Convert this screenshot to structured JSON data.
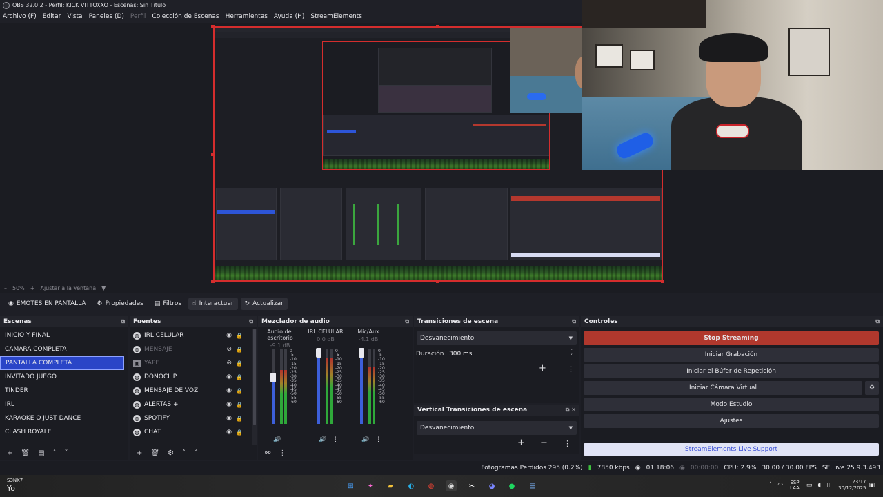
{
  "window": {
    "title": "OBS 32.0.2 - Perfil: KICK VITTOXXO - Escenas: Sin Título"
  },
  "menu": {
    "items": [
      {
        "label": "Archivo (F)",
        "dim": false
      },
      {
        "label": "Editar",
        "dim": false
      },
      {
        "label": "Vista",
        "dim": false
      },
      {
        "label": "Paneles (D)",
        "dim": false
      },
      {
        "label": "Perfil",
        "dim": true
      },
      {
        "label": "Colección de Escenas",
        "dim": false
      },
      {
        "label": "Herramientas",
        "dim": false
      },
      {
        "label": "Ayuda (H)",
        "dim": false
      },
      {
        "label": "StreamElements",
        "dim": false
      }
    ]
  },
  "zoom": {
    "minus": "–",
    "percent": "50%",
    "plus": "+",
    "fit": "Ajustar a la ventana",
    "dropdown": "▼"
  },
  "toolbar": {
    "scene_name": "EMOTES EN PANTALLA",
    "properties": "Propiedades",
    "filters": "Filtros",
    "interact": "Interactuar",
    "refresh": "Actualizar"
  },
  "scenes": {
    "title": "Escenas",
    "items": [
      "INICIO Y FINAL",
      "CAMARA COMPLETA",
      "PANTALLA COMPLETA",
      "INVITADO JUEGO",
      "TINDER",
      "IRL",
      "KARAOKE O JUST DANCE",
      "CLASH ROYALE"
    ],
    "selected_index": 2
  },
  "sources": {
    "title": "Fuentes",
    "items": [
      {
        "label": "IRL CELULAR",
        "dim": false,
        "icon": "globe-icon"
      },
      {
        "label": "MENSAJE",
        "dim": true,
        "icon": "globe-icon"
      },
      {
        "label": "YAPE",
        "dim": true,
        "icon": "image-icon"
      },
      {
        "label": "DONOCLIP",
        "dim": false,
        "icon": "globe-icon"
      },
      {
        "label": "MENSAJE DE VOZ",
        "dim": false,
        "icon": "globe-icon"
      },
      {
        "label": "ALERTAS +",
        "dim": false,
        "icon": "globe-icon"
      },
      {
        "label": "SPOTIFY",
        "dim": false,
        "icon": "globe-icon"
      },
      {
        "label": "CHAT",
        "dim": false,
        "icon": "globe-icon"
      }
    ]
  },
  "mixer": {
    "title": "Mezclador de audio",
    "channels": [
      {
        "name": "Audio del escritorio",
        "db": "-9.1 dB",
        "level": 0.72,
        "fader": 0.62
      },
      {
        "name": "IRL CELULAR",
        "db": "0.0 dB",
        "level": 0.88,
        "fader": 0.95
      },
      {
        "name": "Mic/Aux",
        "db": "-4.1 dB",
        "level": 0.76,
        "fader": 0.95
      }
    ],
    "scale": [
      "0",
      "-5",
      "-10",
      "-15",
      "-20",
      "-25",
      "-30",
      "-35",
      "-40",
      "-45",
      "-50",
      "-55",
      "-60"
    ]
  },
  "transitions": {
    "title": "Transiciones de escena",
    "selected": "Desvanecimiento",
    "duration_label": "Duración",
    "duration_value": "300 ms"
  },
  "vertical_transitions": {
    "title": "Vertical Transiciones de escena",
    "selected": "Desvanecimiento"
  },
  "controls": {
    "title": "Controles",
    "stop_streaming": "Stop Streaming",
    "start_recording": "Iniciar Grabación",
    "start_replay": "Iniciar el Búfer de Repetición",
    "start_vcam": "Iniciar Cámara Virtual",
    "studio_mode": "Modo Estudio",
    "settings": "Ajustes",
    "se_support": "StreamElements Live Support"
  },
  "status": {
    "dropped": "Fotogramas Perdidos 295 (0.2%)",
    "bitrate": "7850 kbps",
    "stream_time": "01:18:06",
    "rec_time": "00:00:00",
    "cpu": "CPU: 2.9%",
    "fps": "30.00 / 30.00 FPS",
    "se_live": "SE.Live 25.9.3.493"
  },
  "taskbar": {
    "user_small": "S3NK7",
    "user_big": "Yo",
    "lang_top": "ESP",
    "lang_bottom": "LAA",
    "time": "23:17",
    "date": "30/12/2025"
  },
  "colors": {
    "accent": "#2a45c7",
    "stop": "#b0382d",
    "preview_border": "#d42d2d"
  }
}
